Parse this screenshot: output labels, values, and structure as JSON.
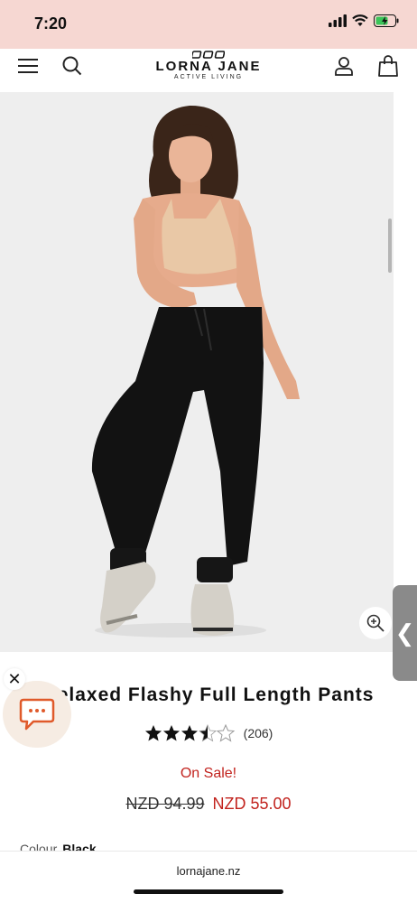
{
  "status": {
    "time": "7:20"
  },
  "header": {
    "brand": "LORNA JANE",
    "tagline": "ACTIVE LIVING",
    "menu_icon": "menu-icon",
    "search_icon": "search-icon",
    "account_icon": "account-icon",
    "bag_icon": "bag-icon"
  },
  "product": {
    "title": "Relaxed Flashy Full Length Pants",
    "rating": 3.5,
    "review_count": "(206)",
    "sale_label": "On Sale!",
    "old_price": "NZD 94.99",
    "new_price": "NZD 55.00",
    "colour_label": "Colour",
    "colour_value": "Black"
  },
  "colors": {
    "sale_red": "#c2231e",
    "status_bar": "#f6d7d2",
    "chat_bg": "#f6ece3",
    "chat_accent": "#e05a2b"
  },
  "browser": {
    "url": "lornajane.nz"
  }
}
